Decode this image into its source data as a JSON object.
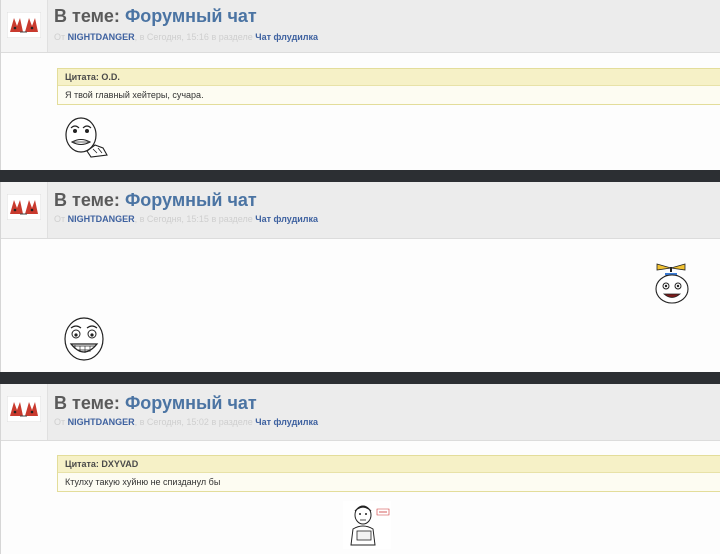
{
  "posts": [
    {
      "title_prefix": "В теме:",
      "title_link": "Форумный чат",
      "meta_from": "От",
      "meta_user": "NIGHTDANGER",
      "meta_time": ", в Сегодня, 15:16 в разделе",
      "meta_section": "Чат флудилка",
      "quote_author": "Цитата: O.D.",
      "quote_text": "Я твой главный хейтеры, сучара.",
      "meme_icon": "rage-face-icon"
    },
    {
      "title_prefix": "В теме:",
      "title_link": "Форумный чат",
      "meta_from": "От",
      "meta_user": "NIGHTDANGER",
      "meta_time": ", в Сегодня, 15:15 в разделе",
      "meta_section": "Чат флудилка",
      "meme_icon": "happy-face-icon",
      "side_icon": "propeller-hat-face-icon"
    },
    {
      "title_prefix": "В теме:",
      "title_link": "Форумный чат",
      "meta_from": "От",
      "meta_user": "NIGHTDANGER",
      "meta_time": ", в Сегодня, 15:02 в разделе",
      "meta_section": "Чат флудилка",
      "quote_author": "Цитата: DXYVAD",
      "quote_text": "Ктулху такую хуйню не спизданул бы",
      "meme_icon": "reading-man-icon"
    }
  ],
  "avatar_icon": "foxes-avatar-icon"
}
